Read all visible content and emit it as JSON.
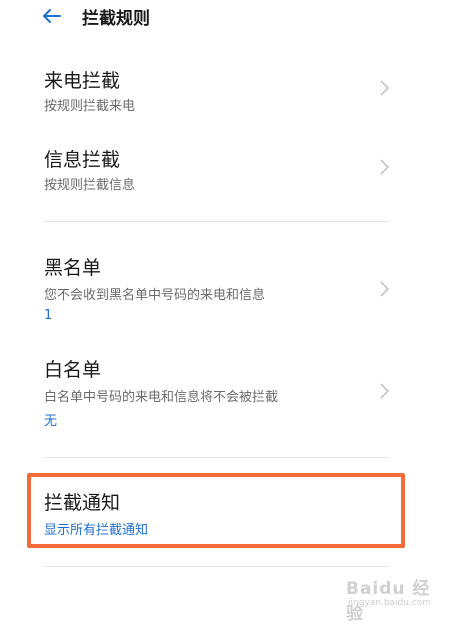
{
  "header": {
    "title": "拦截规则",
    "back_icon": "arrow-left-icon"
  },
  "rules": [
    {
      "title": "来电拦截",
      "subtitle": "按规则拦截来电"
    },
    {
      "title": "信息拦截",
      "subtitle": "按规则拦截信息"
    }
  ],
  "lists": [
    {
      "title": "黑名单",
      "subtitle": "您不会收到黑名单中号码的来电和信息",
      "value": "1"
    },
    {
      "title": "白名单",
      "subtitle": "白名单中号码的来电和信息将不会被拦截",
      "value": "无"
    }
  ],
  "notice": {
    "title": "拦截通知",
    "value": "显示所有拦截通知"
  },
  "watermark": {
    "logo": "Baidu 经验",
    "url": "jingyan.baidu.com"
  },
  "colors": {
    "accent": "#1f6fd6",
    "highlight": "#f26b3a",
    "divider": "#e6e6e6"
  }
}
